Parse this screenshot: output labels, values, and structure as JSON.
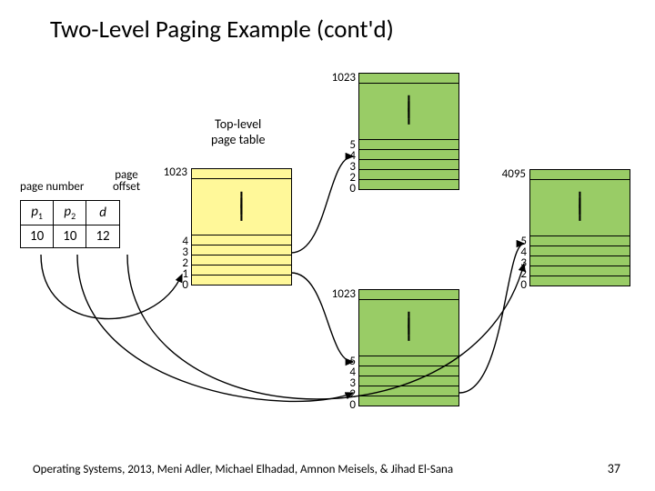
{
  "title": "Two-Level Paging Example (cont'd)",
  "top_level_label": "Top-level\npage table",
  "addr": {
    "page_number_label": "page number",
    "page_offset_label": "page\noffset",
    "p1": "p",
    "p1_sub": "1",
    "p2": "p",
    "p2_sub": "2",
    "d": "d",
    "v1": "10",
    "v2": "10",
    "v3": "12"
  },
  "t": {
    "inner_top_high": "1023",
    "inner_top_lo5": "5",
    "inner_top_lo4": "4",
    "inner_top_lo3": "3",
    "inner_top_lo2": "2",
    "inner_top_lo0": "0",
    "top_1023": "1023",
    "top_lo4": "4",
    "top_lo3": "3",
    "top_lo2": "2",
    "top_lo1": "1",
    "top_lo0": "0",
    "inner_bot_high": "1023",
    "inner_bot_lo5": "5",
    "inner_bot_lo4": "4",
    "inner_bot_lo3": "3",
    "inner_bot_lo2": "2",
    "inner_bot_lo0": "0",
    "page_high": "4095",
    "page_lo5": "5",
    "page_lo4": "4",
    "page_lo3": "3",
    "page_lo2": "2",
    "page_lo0": "0"
  },
  "footer": "Operating Systems, 2013, Meni Adler, Michael Elhadad, Amnon Meisels, & Jihad El-Sana",
  "slidenum": "37"
}
